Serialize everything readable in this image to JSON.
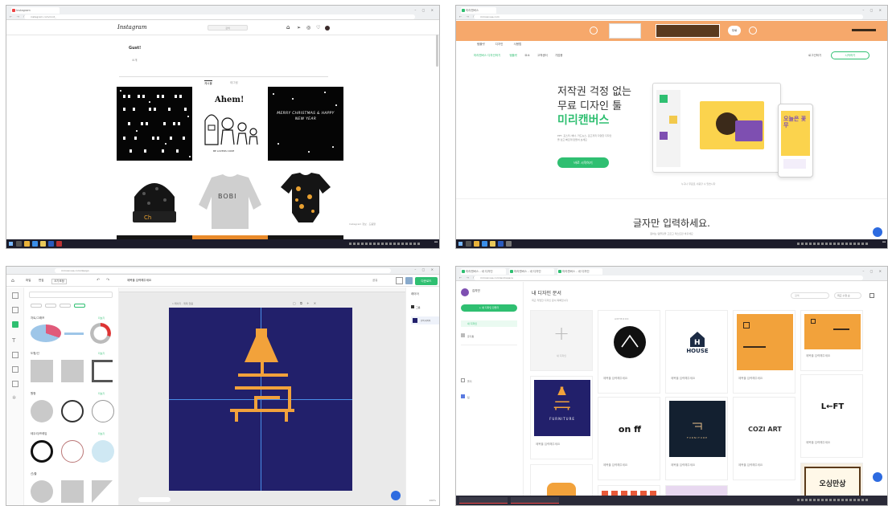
{
  "instagram": {
    "tab": "Instagram",
    "url": "instagram.com/cnxt_",
    "logo": "Instagram",
    "search_placeholder": "검색",
    "nav_icons": [
      "home-icon",
      "send-icon",
      "compass-icon",
      "heart-icon",
      "avatar-icon"
    ],
    "profile_name": "Gust!",
    "profile_sub": "소개",
    "tabs": [
      "게시물",
      "태그됨"
    ],
    "posts": [
      "Ahem!",
      "MERRY CHRISTMAS & HAPPY NEW YEAR",
      "BOBI"
    ],
    "ahem_sub": "BE LOVERS CODE",
    "footer_text": "Instagram 정보 · 도움말"
  },
  "miricanvas_home": {
    "tab": "미리캔버스",
    "url": "miricanvas.com",
    "banner_badge": "무료",
    "menu": [
      "템플릿",
      "디자인",
      "사용법"
    ],
    "nav": [
      "미리캔버스 디자인하기",
      "템플릿",
      "요소",
      "고객센터",
      "기업용"
    ],
    "login": "로그인하기",
    "signup": "시작하기",
    "hero_line1": "저작권 걱정 없는",
    "hero_line2": "무료 디자인 툴",
    "hero_brand": "미리캔버스",
    "hero_desc": "PPT, 포스터, 배너, 카드뉴스, 로고까지 다양한 디자인을 쉽고 빠르게 만들어 보세요",
    "hero_button": "바로 시작하기",
    "hero_note": "누구나 무료로 사용할 수 있습니다",
    "section_title": "글자만 입력하세요.",
    "section_sub": "원하는 템플릿을 고르고 텍스트만 바꾸세요",
    "phone_word": "오늘은 꽃무"
  },
  "editor": {
    "doc_title": "제목을 입력해주세요",
    "url": "miricanvas.com/design",
    "menu": [
      "파일",
      "편집",
      "크기조정"
    ],
    "download": "다운로드",
    "share": "공유",
    "page_label": "1 페이지 - 제목 없음",
    "layer_title": "레이어",
    "layer_items": [
      "그룹",
      "선택 레이어"
    ],
    "categories": [
      "차트/그래프",
      "도형/선",
      "원형",
      "테두리/프레임",
      "선/줄"
    ],
    "more": "더보기",
    "zoom": "100%"
  },
  "my_designs": {
    "tab": "미리캔버스 - 내 디자인",
    "url": "miricanvas.com/workspace",
    "user_name": "김지민",
    "new_button": "+ 새 디자인 만들기",
    "sidebar": [
      "내 디자인",
      "휴지통",
      "폴더",
      "팀"
    ],
    "title": "내 디자인 문서",
    "subtitle": "최근 작업한 디자인 문서 목록입니다",
    "search_placeholder": "검색",
    "sort": "최근 수정 순",
    "logos": [
      "ARTBOOK",
      "HOUSE",
      "FURNITURE",
      "on ff",
      "FURNITURE",
      "COZI ART",
      "L←FT",
      "오싱만상"
    ],
    "card_label": "제목을 입력해주세요",
    "new_card": "새 디자인"
  },
  "colors": {
    "miri_green": "#2fbf71",
    "orange": "#f2a23b",
    "navy": "#22206b",
    "peach": "#f6a86b",
    "purple": "#7e4fb1"
  }
}
